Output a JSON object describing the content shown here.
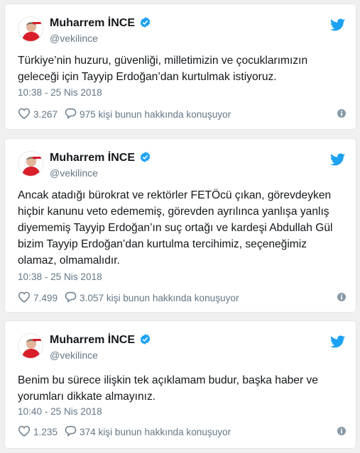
{
  "tweets": [
    {
      "name": "Muharrem İNCE",
      "handle": "@vekilince",
      "text": "Türkiye’nin huzuru, güvenliği, milletimizin ve çocuklarımızın\ngeleceği için Tayyip Erdoğan’dan kurtulmak istiyoruz.",
      "time": "10:38 - 25 Nis 2018",
      "likes": "3.267",
      "replies": "975 kişi bunun hakkında konuşuyor"
    },
    {
      "name": "Muharrem İNCE",
      "handle": "@vekilince",
      "text": "Ancak atadığı bürokrat ve rektörler FETÖcü çıkan, görevdeyken\nhiçbir kanunu veto edememiş, görevden ayrılınca yanlışa yanlış\ndiyememiş Tayyip Erdoğan’ın suç ortağı ve kardeşi Abdullah Gül\nbizim Tayyip Erdoğan’dan kurtulma tercihimiz, seçeneğimiz\nolamaz, olmamalıdır.",
      "time": "10:38 - 25 Nis 2018",
      "likes": "7.499",
      "replies": "3.057 kişi bunun hakkında konuşuyor"
    },
    {
      "name": "Muharrem İNCE",
      "handle": "@vekilince",
      "text": "Benim bu sürece ilişkin tek açıklamam budur, başka haber ve\nyorumları dikkate almayınız.",
      "time": "10:40 - 25 Nis 2018",
      "likes": "1.235",
      "replies": "374 kişi bunun hakkında konuşuyor"
    }
  ],
  "icons": {
    "verified": "verified-badge-icon",
    "twitter": "twitter-bird-icon",
    "like": "heart-icon",
    "reply": "speech-bubble-icon",
    "info": "info-icon"
  },
  "colors": {
    "brand": "#1da1f2",
    "text": "#14171a",
    "muted": "#657786",
    "border": "#e1e8ed"
  }
}
